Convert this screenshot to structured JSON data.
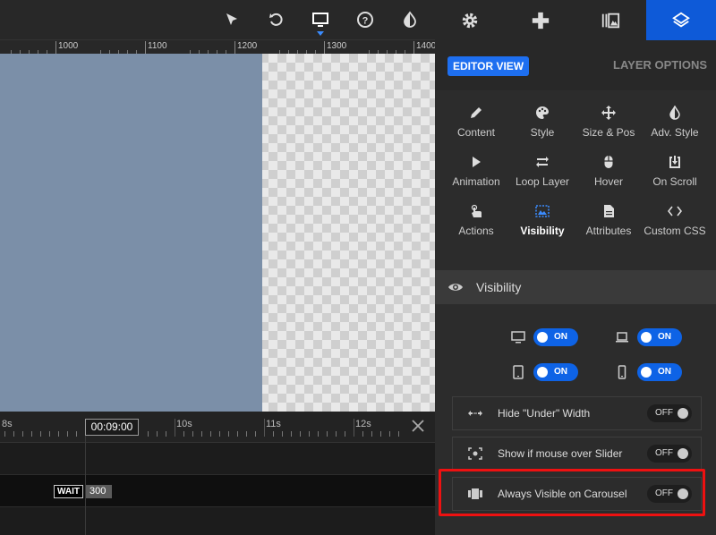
{
  "toolbar": {
    "icons": [
      "pointer-icon",
      "undo-icon",
      "desktop-icon",
      "help-icon",
      "contrast-icon"
    ]
  },
  "ruler": {
    "labels": [
      "1000",
      "1100",
      "1200",
      "1300",
      "1400"
    ]
  },
  "timeline": {
    "labels": [
      "8s",
      "10s",
      "11s",
      "12s"
    ],
    "current_time": "00:09:00",
    "wait_label": "WAIT",
    "wait_value": "300"
  },
  "panel": {
    "tabs": [
      "gear-icon",
      "gamepad-icon",
      "media-icon",
      "layers-icon"
    ],
    "editor_view_label": "EDITOR VIEW",
    "layer_options_label": "LAYER OPTIONS",
    "grid": [
      {
        "label": "Content",
        "icon": "pencil-icon"
      },
      {
        "label": "Style",
        "icon": "palette-icon"
      },
      {
        "label": "Size & Pos",
        "icon": "move-icon"
      },
      {
        "label": "Adv. Style",
        "icon": "contrast-icon"
      },
      {
        "label": "Animation",
        "icon": "play-icon"
      },
      {
        "label": "Loop Layer",
        "icon": "loop-icon"
      },
      {
        "label": "Hover",
        "icon": "mouse-icon"
      },
      {
        "label": "On Scroll",
        "icon": "download-box-icon"
      },
      {
        "label": "Actions",
        "icon": "touch-icon"
      },
      {
        "label": "Visibility",
        "icon": "visibility-screen-icon"
      },
      {
        "label": "Attributes",
        "icon": "document-icon"
      },
      {
        "label": "Custom CSS",
        "icon": "code-icon"
      }
    ],
    "section_title": "Visibility",
    "devices": [
      {
        "icon": "desktop-icon",
        "state": "ON"
      },
      {
        "icon": "laptop-icon",
        "state": "ON"
      },
      {
        "icon": "tablet-icon",
        "state": "ON"
      },
      {
        "icon": "phone-icon",
        "state": "ON"
      }
    ],
    "options": [
      {
        "label": "Hide \"Under\" Width",
        "state": "OFF",
        "icon": "width-arrows-icon"
      },
      {
        "label": "Show if mouse over Slider",
        "state": "OFF",
        "icon": "focus-icon"
      },
      {
        "label": "Always Visible on Carousel",
        "state": "OFF",
        "icon": "carousel-icon"
      }
    ]
  },
  "colors": {
    "accent": "#0e63e6",
    "highlight": "#ee1111",
    "slide": "#7b8fa8"
  }
}
